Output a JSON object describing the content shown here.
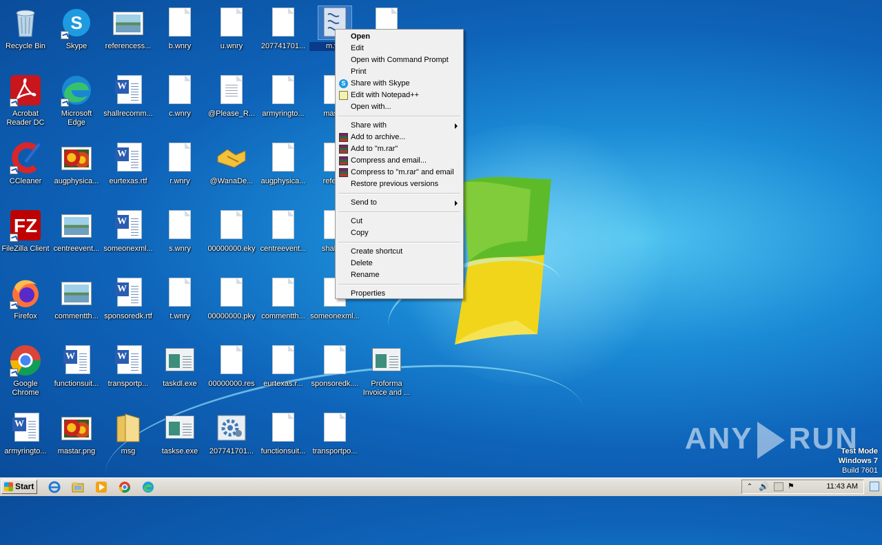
{
  "desktop": {
    "icons": [
      {
        "label": "Recycle Bin",
        "kind": "recycle"
      },
      {
        "label": "Skype",
        "kind": "skype"
      },
      {
        "label": "referencess...",
        "kind": "picture"
      },
      {
        "label": "b.wnry",
        "kind": "doc"
      },
      {
        "label": "u.wnry",
        "kind": "doc"
      },
      {
        "label": "207741701...",
        "kind": "doc"
      },
      {
        "label": "m.v...",
        "kind": "script"
      },
      {
        "label": "",
        "kind": "doc"
      },
      {
        "label": "Acrobat Reader DC",
        "kind": "acrobat"
      },
      {
        "label": "Microsoft Edge",
        "kind": "edge"
      },
      {
        "label": "shallrecomm...",
        "kind": "word"
      },
      {
        "label": "c.wnry",
        "kind": "doc"
      },
      {
        "label": "@Please_R...",
        "kind": "textdoc"
      },
      {
        "label": "armyringto...",
        "kind": "doc"
      },
      {
        "label": "mastar",
        "kind": "doc"
      },
      {
        "label": "CCleaner",
        "kind": "ccleaner"
      },
      {
        "label": "augphysica...",
        "kind": "flowers"
      },
      {
        "label": "eurtexas.rtf",
        "kind": "word"
      },
      {
        "label": "r.wnry",
        "kind": "doc"
      },
      {
        "label": "@WanaDe...",
        "kind": "handshake"
      },
      {
        "label": "augphysica...",
        "kind": "doc"
      },
      {
        "label": "referen",
        "kind": "doc"
      },
      {
        "label": "FileZilla Client",
        "kind": "filezilla"
      },
      {
        "label": "centreevent...",
        "kind": "picture"
      },
      {
        "label": "someonexml...",
        "kind": "word"
      },
      {
        "label": "s.wnry",
        "kind": "doc"
      },
      {
        "label": "00000000.eky",
        "kind": "doc"
      },
      {
        "label": "centreevent...",
        "kind": "doc"
      },
      {
        "label": "shallrec",
        "kind": "doc"
      },
      {
        "label": "Firefox",
        "kind": "firefox"
      },
      {
        "label": "commentth...",
        "kind": "picture"
      },
      {
        "label": "sponsoredk.rtf",
        "kind": "word"
      },
      {
        "label": "t.wnry",
        "kind": "doc"
      },
      {
        "label": "00000000.pky",
        "kind": "doc"
      },
      {
        "label": "commentth...",
        "kind": "doc"
      },
      {
        "label": "someonexml...",
        "kind": "doc"
      },
      {
        "label": "Google Chrome",
        "kind": "chrome"
      },
      {
        "label": "functionsuit...",
        "kind": "word"
      },
      {
        "label": "transportp...",
        "kind": "word"
      },
      {
        "label": "taskdl.exe",
        "kind": "exe"
      },
      {
        "label": "00000000.res",
        "kind": "doc"
      },
      {
        "label": "eurtexas.r...",
        "kind": "doc"
      },
      {
        "label": "sponsoredk....",
        "kind": "doc"
      },
      {
        "label": "Proforma Invoice and ...",
        "kind": "exe"
      },
      {
        "label": "armyringto...",
        "kind": "word"
      },
      {
        "label": "mastar.png",
        "kind": "flowers"
      },
      {
        "label": "msg",
        "kind": "folder"
      },
      {
        "label": "taskse.exe",
        "kind": "exe"
      },
      {
        "label": "207741701...",
        "kind": "gear"
      },
      {
        "label": "functionsuit...",
        "kind": "doc"
      },
      {
        "label": "transportpo...",
        "kind": "doc"
      }
    ]
  },
  "context_menu": {
    "items": [
      {
        "label": "Open"
      },
      {
        "label": "Edit"
      },
      {
        "label": "Open with Command Prompt"
      },
      {
        "label": "Print"
      },
      {
        "label": "Share with Skype",
        "icon": "skype-icon"
      },
      {
        "label": "Edit with Notepad++",
        "icon": "notepadpp-icon"
      },
      {
        "label": "Open with..."
      },
      {
        "label": "Share with"
      },
      {
        "label": "Add to archive...",
        "icon": "winrar-icon"
      },
      {
        "label": "Add to \"m.rar\"",
        "icon": "winrar-icon"
      },
      {
        "label": "Compress and email...",
        "icon": "winrar-icon"
      },
      {
        "label": "Compress to \"m.rar\" and email",
        "icon": "winrar-icon"
      },
      {
        "label": "Restore previous versions"
      },
      {
        "label": "Send to"
      },
      {
        "label": "Cut"
      },
      {
        "label": "Copy"
      },
      {
        "label": "Create shortcut"
      },
      {
        "label": "Delete"
      },
      {
        "label": "Rename"
      },
      {
        "label": "Properties"
      }
    ]
  },
  "watermark": {
    "left": "ANY",
    "right": "RUN"
  },
  "test_mode": {
    "line1": "Test Mode",
    "line2": "Windows 7",
    "line3": "Build 7601"
  },
  "taskbar": {
    "start_label": "Start",
    "clock": "11:43 AM",
    "pinned": [
      "internet-explorer-icon",
      "explorer-icon",
      "media-player-icon",
      "chrome-icon",
      "edge-icon"
    ]
  }
}
